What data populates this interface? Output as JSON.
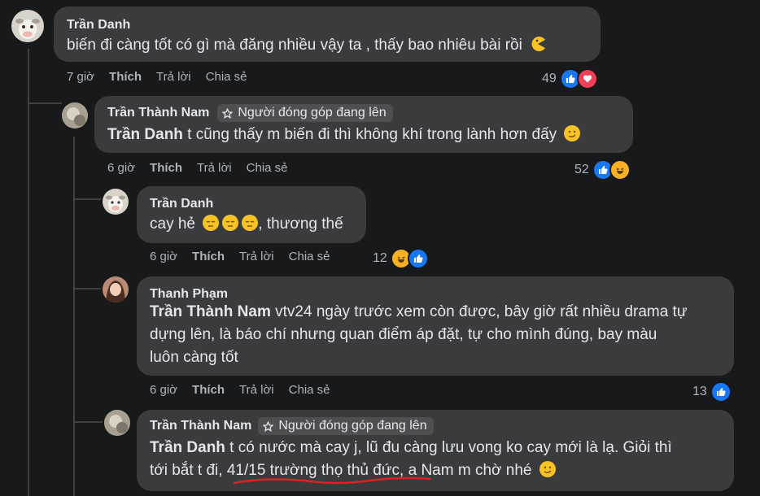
{
  "comments": [
    {
      "author": "Trần Danh",
      "text": "biến đi càng tốt có gì mà đăng nhiều vậy ta , thấy bao nhiêu bài rồi",
      "time": "7 giờ",
      "like": "Thích",
      "reply": "Trả lời",
      "share": "Chia sẻ",
      "reactions": "49"
    },
    {
      "author": "Trần Thành Nam",
      "badge": "Người đóng góp đang lên",
      "mention": "Trần Danh",
      "text": " t cũng thấy m biến đi thì không khí trong lành hơn đấy",
      "time": "6 giờ",
      "like": "Thích",
      "reply": "Trả lời",
      "share": "Chia sẻ",
      "reactions": "52"
    },
    {
      "author": "Trần Danh",
      "text": "cay hẻ",
      "text_after": ", thương thế",
      "time": "6 giờ",
      "like": "Thích",
      "reply": "Trả lời",
      "share": "Chia sẻ",
      "reactions": "12"
    },
    {
      "author": "Thanh Phạm",
      "mention": "Trần Thành Nam",
      "line1": " vtv24 ngày trước xem còn được, bây giờ rất nhiều drama tự",
      "line2": "dựng lên, là báo chí nhưng quan điểm áp đặt, tự cho mình đúng, bay màu",
      "line3": "luôn càng tốt",
      "time": "6 giờ",
      "like": "Thích",
      "reply": "Trả lời",
      "share": "Chia sẻ",
      "reactions": "13"
    },
    {
      "author": "Trần Thành Nam",
      "badge": "Người đóng góp đang lên",
      "mention": "Trần Danh",
      "line1": " t có nước mà cay j, lũ đu càng lưu vong ko cay mới là lạ. Giỏi thì",
      "line2_pre": "tới bắt t đi, ",
      "line2_underlined": "41/15 trường thọ thủ đức",
      "line2_post": ", a Nam m chờ nhé"
    }
  ],
  "colors": {
    "background": "#18191a",
    "bubble": "#3a3b3c",
    "like_blue": "#1877f2",
    "love_red": "#f33e58",
    "annotation_red": "#e02020"
  }
}
